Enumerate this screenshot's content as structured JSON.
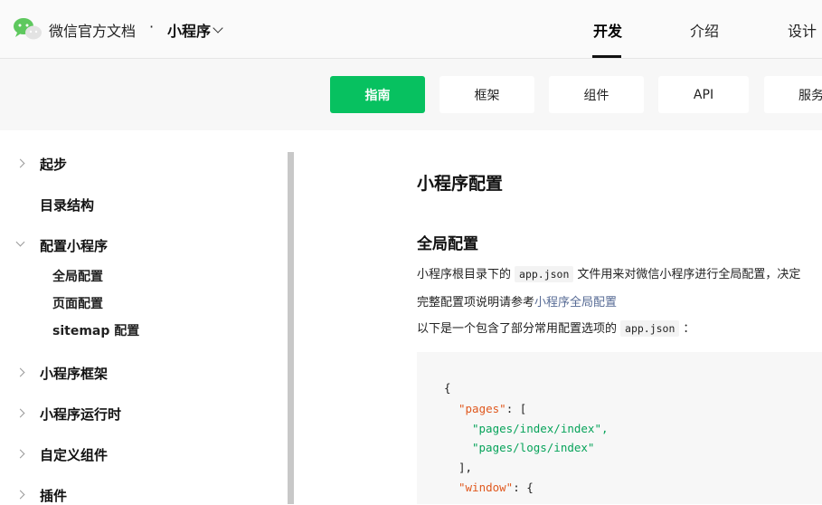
{
  "header": {
    "brand": "微信官方文档",
    "separator": "·",
    "product": "小程序",
    "nav": [
      "开发",
      "介绍",
      "设计"
    ]
  },
  "subnav": {
    "tabs": [
      "指南",
      "框架",
      "组件",
      "API",
      "服务"
    ]
  },
  "sidebar": {
    "items": [
      {
        "label": "起步"
      },
      {
        "label": "目录结构"
      },
      {
        "label": "配置小程序"
      },
      {
        "label": "小程序框架"
      },
      {
        "label": "小程序运行时"
      },
      {
        "label": "自定义组件"
      },
      {
        "label": "插件"
      }
    ],
    "subitems": [
      "全局配置",
      "页面配置",
      "sitemap 配置"
    ]
  },
  "main": {
    "title": "小程序配置",
    "section": "全局配置",
    "p1_before": "小程序根目录下的",
    "p1_code": "app.json",
    "p1_after": "文件用来对微信小程序进行全局配置，决定",
    "p2_before": "完整配置项说明请参考",
    "p2_link": "小程序全局配置",
    "p3_before": "以下是一个包含了部分常用配置选项的",
    "p3_code": "app.json",
    "p3_after": "：",
    "code": {
      "open_brace": "{",
      "key_pages": "\"pages\"",
      "colon_bracket": ": [",
      "page1": "\"pages/index/index\",",
      "page2": "\"pages/logs/index\"",
      "close_bracket": "],",
      "key_window": "\"window\"",
      "colon_brace": ": {"
    }
  },
  "colors": {
    "accent": "#07c160",
    "link": "#576b95",
    "code_key": "#e0591f",
    "code_string": "#07a35a"
  }
}
